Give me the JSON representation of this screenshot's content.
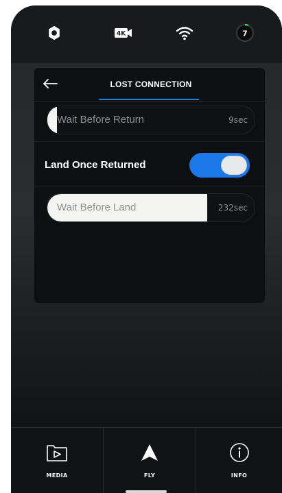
{
  "status_bar": {
    "settings_icon": "gear-icon",
    "camera_badge": "4K",
    "wifi_icon": "wifi-icon",
    "battery_count": "7"
  },
  "panel": {
    "title": "LOST CONNECTION",
    "back_icon": "arrow-left-icon",
    "wait_before_return": {
      "label": "Wait Before Return",
      "value": "9sec",
      "fill_fraction": 0.04
    },
    "land_once_returned": {
      "label": "Land Once Returned",
      "enabled": true
    },
    "wait_before_land": {
      "label": "Wait Before Land",
      "value": "232sec",
      "fill_fraction": 0.77
    }
  },
  "nav": {
    "media": "MEDIA",
    "fly": "FLY",
    "info": "INFO"
  },
  "colors": {
    "accent": "#1e83e6",
    "toggle_on": "#1a78e8",
    "battery_ring": "#2ecc40"
  }
}
